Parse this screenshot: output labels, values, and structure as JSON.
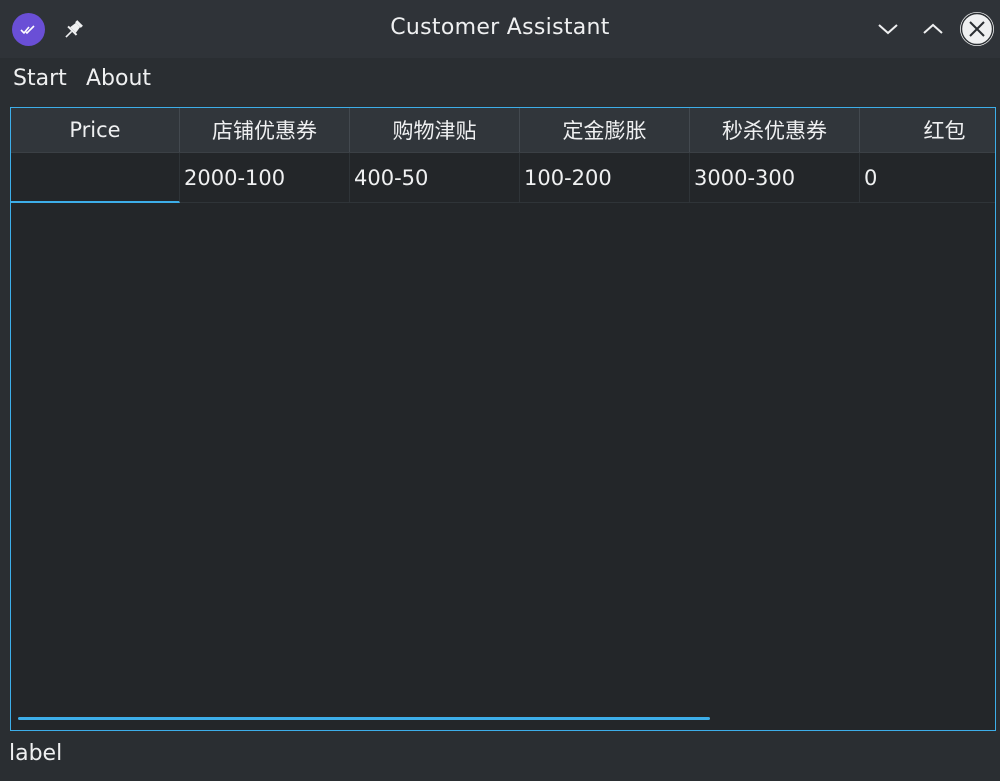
{
  "window": {
    "title": "Customer Assistant"
  },
  "icons": {
    "app": "app-check-icon",
    "pin": "pin-icon",
    "minimize": "chevron-down-icon",
    "maximize": "chevron-up-icon",
    "close": "close-icon"
  },
  "menu": {
    "items": [
      {
        "label": "Start"
      },
      {
        "label": "About"
      }
    ]
  },
  "table": {
    "columns": [
      "Price",
      "店铺优惠券",
      "购物津贴",
      "定金膨胀",
      "秒杀优惠券",
      "红包"
    ],
    "rows": [
      [
        "",
        "2000-100",
        "400-50",
        "100-200",
        "3000-300",
        "0"
      ]
    ]
  },
  "status": {
    "label": "label"
  },
  "colors": {
    "accent": "#3daee9",
    "app_icon": "#6a4fd6",
    "background": "#2a2e32",
    "table_background": "#232629"
  }
}
